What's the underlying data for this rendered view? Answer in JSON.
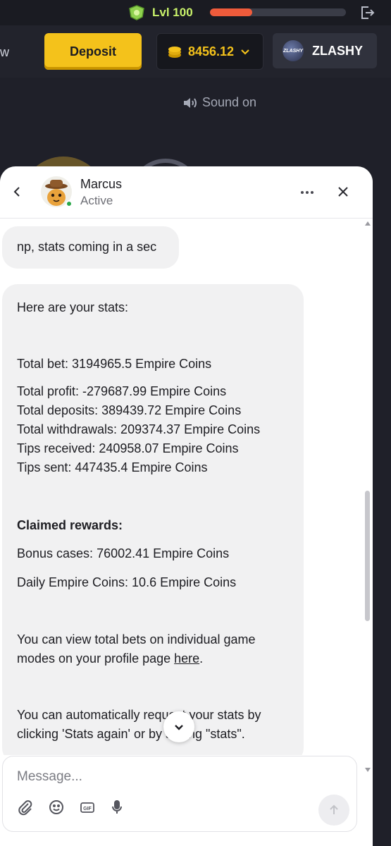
{
  "topbar": {
    "level_label": "Lvl 100",
    "xp_fraction": 0.31
  },
  "header": {
    "cut_left_text": "w",
    "deposit_label": "Deposit",
    "balance": "8456.12",
    "username": "ZLASHY",
    "avatar_text": "ZLASHY"
  },
  "sound_label": "Sound on",
  "chat": {
    "agent_name": "Marcus",
    "agent_status": "Active",
    "messages": {
      "m1": "np, stats coming in a sec",
      "m2": {
        "intro": "Here are your stats:",
        "total_bet": "Total bet: 3194965.5 Empire Coins",
        "total_profit": "Total profit: -279687.99 Empire Coins",
        "total_deposits": "Total deposits: 389439.72 Empire Coins",
        "total_withdrawals": "Total withdrawals: 209374.37 Empire Coins",
        "tips_received": "Tips received: 240958.07 Empire Coins",
        "tips_sent": "Tips sent: 447435.4 Empire Coins",
        "claimed_heading": "Claimed rewards:",
        "bonus_cases": "Bonus cases: 76002.41 Empire Coins",
        "daily_coins": "Daily Empire Coins: 10.6 Empire Coins",
        "view_line1": "You can view total bets on individual game",
        "view_line2_pre": "modes on your profile page ",
        "view_link": "here",
        "view_line2_post": ".",
        "auto_line1": "You can automatically request your stats by",
        "auto_line2": "clicking 'Stats again' or by saying \"stats\"."
      }
    },
    "composer": {
      "placeholder": "Message..."
    }
  },
  "colors": {
    "accent_yellow": "#f4c21b",
    "level_green": "#c9f26b",
    "xp_orange": "#ef5b3b",
    "online_green": "#2ba84a"
  }
}
